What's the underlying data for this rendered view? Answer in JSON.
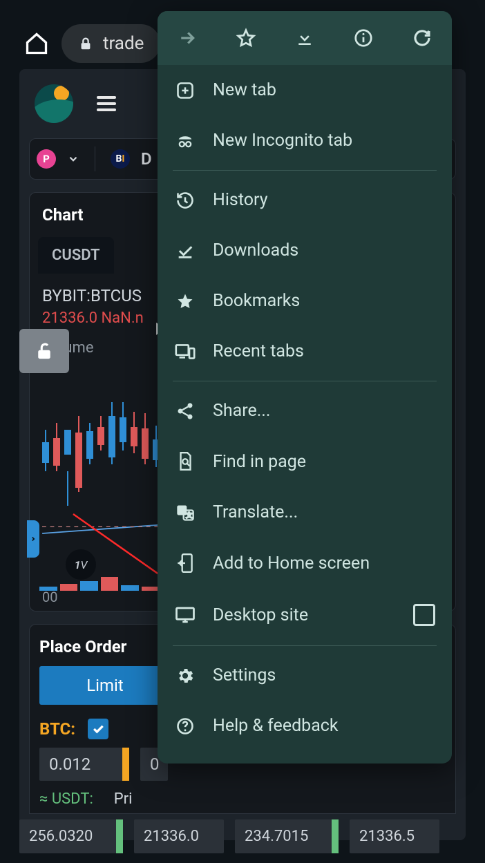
{
  "browser": {
    "url_fragment": "trade"
  },
  "app": {
    "pair_tab": "CUSDT",
    "exchange_line": "BYBIT:BTCUS",
    "price_line_a": "21336.0",
    "price_line_b": "NaN.n",
    "chart_label": "Chart",
    "volume_label": "Volume",
    "bottom_axis": "00",
    "top_d_letter": "D"
  },
  "order": {
    "title": "Place Order",
    "limit_label": "Limit",
    "base_label": "BTC:",
    "usdt_label": "≈ USDT:",
    "price_lbl": "Pri",
    "qty1": "0.012",
    "qty2": "0",
    "bn1": "256.0320",
    "bn2": "21336.0",
    "bn3": "234.7015",
    "bn4": "21336.5"
  },
  "menu": {
    "new_tab": "New tab",
    "incognito": "New Incognito tab",
    "history": "History",
    "downloads": "Downloads",
    "bookmarks": "Bookmarks",
    "recent": "Recent tabs",
    "share": "Share...",
    "find": "Find in page",
    "translate": "Translate...",
    "add_home": "Add to Home screen",
    "desktop": "Desktop site",
    "settings": "Settings",
    "help": "Help & feedback"
  }
}
